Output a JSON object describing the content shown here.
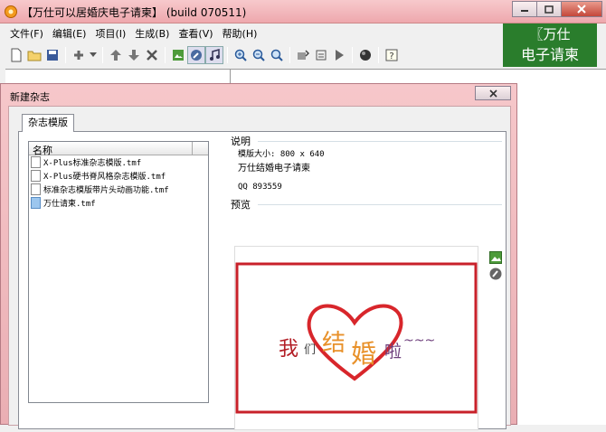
{
  "window": {
    "title": "【万仕可以居婚庆电子请柬】 (build 070511)"
  },
  "menu": [
    "文件(F)",
    "编辑(E)",
    "项目(I)",
    "生成(B)",
    "查看(V)",
    "帮助(H)"
  ],
  "brand": {
    "line1": "〖万仕",
    "line2": "电子请柬",
    "color": "#2a7d2c"
  },
  "dialog": {
    "title": "新建杂志",
    "tab": "杂志模版",
    "list_header": "名称",
    "files": [
      "X-Plus标准杂志模版.tmf",
      "X-Plus硬书脊风格杂志模版.tmf",
      "标准杂志模版带片头动画功能.tmf",
      "万仕请柬.tmf"
    ],
    "selected_file": "万仕请柬.tmf",
    "description_label": "说明",
    "description": {
      "size": "模版大小: 800 x 640",
      "name": "万仕结婚电子请柬",
      "qq": "QQ 893559"
    },
    "preview_label": "预览",
    "preview_text": {
      "wo": "我",
      "men": "们",
      "jie": "结",
      "hun": "婚",
      "la": "啦",
      "tilde": "~~~"
    }
  },
  "colors": {
    "dialog_frame": "#eaaeb3",
    "heart": "#d8262b",
    "frame": "#c8212a",
    "accent_orange": "#e8912a",
    "accent_purple": "#6e3f7c"
  }
}
